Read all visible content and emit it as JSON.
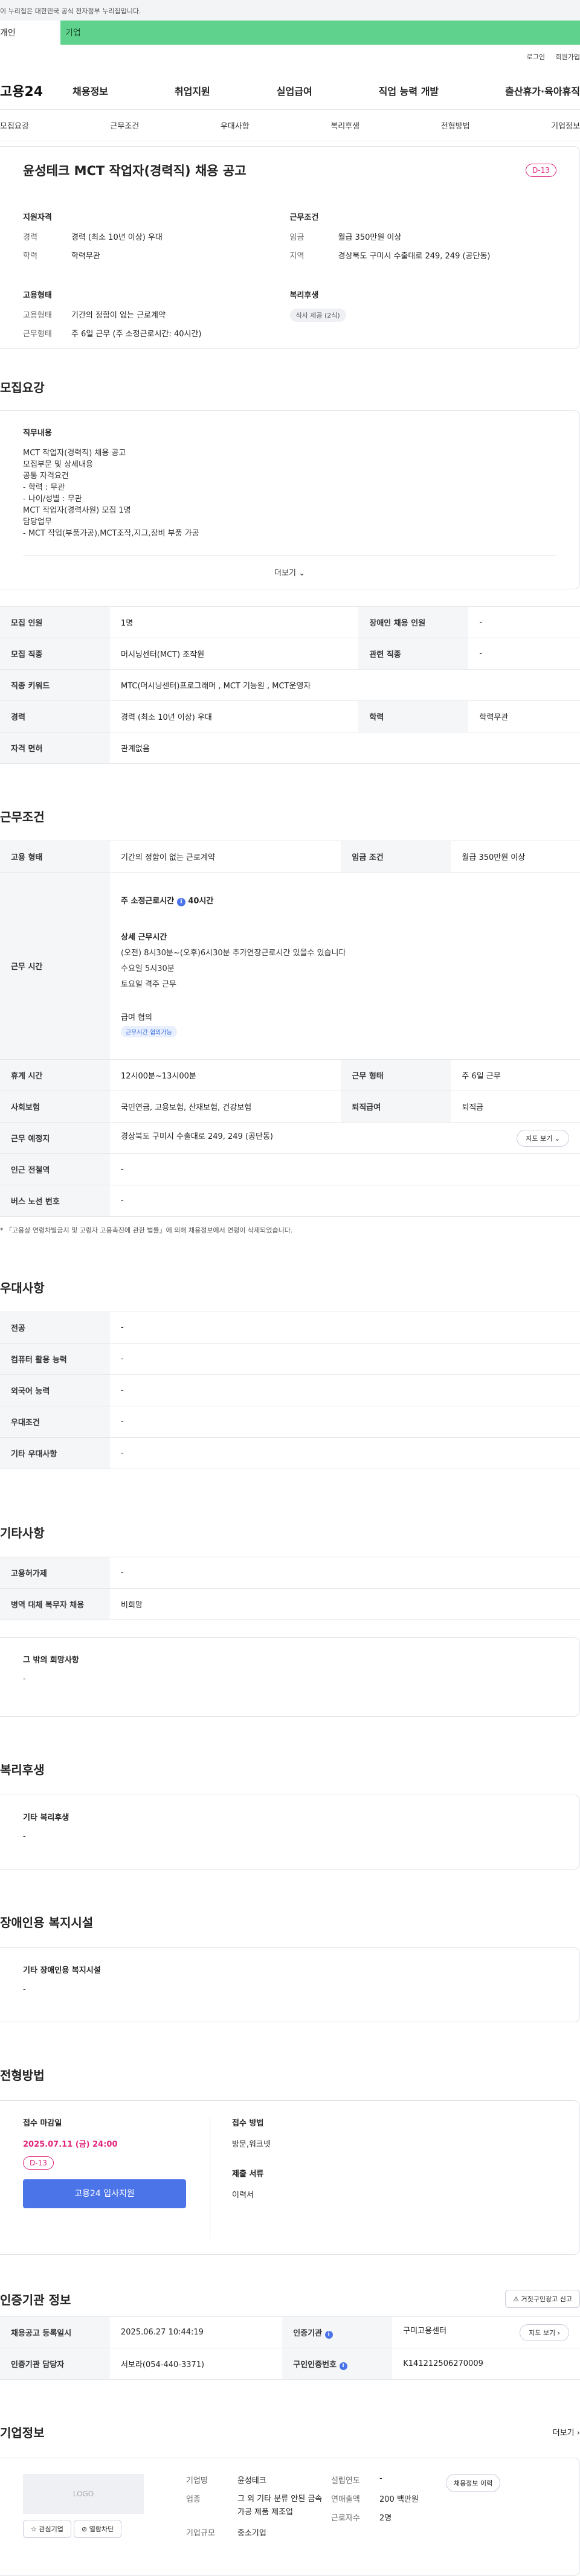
{
  "gov_notice": "이 누리집은 대한민국 공식 전자정부 누리집입니다.",
  "segment": {
    "left": "개인",
    "right": "기업"
  },
  "util": {
    "login": "로그인",
    "join": "회원가입"
  },
  "site": {
    "logo": "고용24"
  },
  "gnb": [
    "채용정보",
    "취업지원",
    "실업급여",
    "직업 능력 개발",
    "출산휴가·육아휴직"
  ],
  "tabs": [
    "모집요강",
    "근무조건",
    "우대사항",
    "복리후생",
    "전형방법",
    "기업정보"
  ],
  "summary": {
    "title": "윤성테크 MCT 작업자(경력직) 채용 공고",
    "dday": "D-13",
    "qual_h": "지원자격",
    "qual": [
      {
        "k": "경력",
        "v": "경력 (최소 10년 이상) 우대"
      },
      {
        "k": "학력",
        "v": "학력무관"
      }
    ],
    "cond_h": "근무조건",
    "cond": [
      {
        "k": "임금",
        "v": "월급 350만원 이상"
      },
      {
        "k": "지역",
        "v": "경상북도 구미시 수출대로 249, 249 (공단동)"
      }
    ],
    "emp_h": "고용형태",
    "emp": [
      {
        "k": "고용형태",
        "v": "기간의 정함이 없는 근로계약"
      },
      {
        "k": "근무형태",
        "v": "주 6일 근무 (주 소정근로시간: 40시간)"
      }
    ],
    "welfare_h": "복리후생",
    "welfare_chip": "식사 제공 (2식)"
  },
  "recruit": {
    "title": "모집요강",
    "detail_h": "직무내용",
    "detail": "MCT 작업자(경력직) 채용 공고\n모집부문 및 상세내용\n공통 자격요건\n- 학력 : 무관\n- 나이/성별 : 무관\nMCT 작업자(경력사원) 모집 1명\n담당업무\n- MCT 작업(부품가공),MCT조작,지그,장비 부품 가공",
    "more": "더보기",
    "rows": [
      {
        "k1": "모집 인원",
        "v1": "1명",
        "k2": "장애인 채용 인원",
        "v2": "-"
      },
      {
        "k1": "모집 직종",
        "v1": "머시닝센터(MCT) 조작원",
        "k2": "관련 직종",
        "v2": "-"
      },
      {
        "k1": "직종 키워드",
        "v1": "MTC(머시닝센터)프로그래머 , MCT 기능원 , MCT운영자"
      },
      {
        "k1": "경력",
        "v1": "경력 (최소 10년 이상) 우대",
        "k2": "학력",
        "v2": "학력무관"
      },
      {
        "k1": "자격 면허",
        "v1": "관계없음"
      }
    ]
  },
  "cond": {
    "title": "근무조건",
    "emp_type_k": "고용 형태",
    "emp_type_v": "기간의 정함이 없는 근로계약",
    "wage_k": "임금 조건",
    "wage_v": "월급 350만원 이상",
    "hours_k": "근무 시간",
    "hours_label": "주 소정근로시간",
    "hours_value": "40시간",
    "hours_detail_h": "상세 근무시간",
    "hours_detail": "(오전) 8시30분~(오후)6시30분   추가연장근로시간 있을수 있습니다\n수요일 5시30분\n토요일 격주 근무",
    "wage_consult": "급여 협의",
    "wage_chip": "근무시간 협의가능",
    "rest_k": "휴게 시간",
    "rest_v": "12시00분~13시00분",
    "shift_k": "근무 형태",
    "shift_v": "주 6일 근무",
    "ins_k": "사회보험",
    "ins_v": "국민연금, 고용보험, 산재보험, 건강보험",
    "sev_k": "퇴직급여",
    "sev_v": "퇴직금",
    "place_k": "근무 예정지",
    "place_v": "경상북도 구미시 수출대로 249, 249 (공단동)",
    "map_btn": "지도 보기",
    "subway_k": "인근 전철역",
    "subway_v": "-",
    "bus_k": "버스 노선 번호",
    "bus_v": "-",
    "note": "* 「고용상 연령차별금지 및 고령자 고용촉진에 관한 법률」에 의해 채용정보에서 연령이 삭제되었습니다."
  },
  "pref": {
    "title": "우대사항",
    "rows": [
      {
        "k": "전공",
        "v": "-"
      },
      {
        "k": "컴퓨터 활용 능력",
        "v": "-"
      },
      {
        "k": "외국어 능력",
        "v": "-"
      },
      {
        "k": "우대조건",
        "v": "-"
      },
      {
        "k": "기타 우대사항",
        "v": "-"
      }
    ]
  },
  "etc": {
    "title": "기타사항",
    "rows": [
      {
        "k": "고용허가제",
        "v": "-"
      },
      {
        "k": "병역 대체 복무자 채용",
        "v": "비희망"
      }
    ],
    "box_h": "그 밖의 희망사항",
    "box_v": "-"
  },
  "welfare": {
    "title": "복리후생",
    "h": "기타 복리후생",
    "v": "-"
  },
  "disab": {
    "title": "장애인용 복지시설",
    "h": "기타 장애인용 복지시설",
    "v": "-"
  },
  "process": {
    "title": "전형방법",
    "deadline_h": "접수 마감일",
    "deadline": "2025.07.11 (금) 24:00",
    "dday": "D-13",
    "apply_btn": "고용24 입사지원",
    "method_h": "접수 방법",
    "method": "방문,워크넷",
    "docs_h": "제출 서류",
    "docs": "이력서"
  },
  "agency": {
    "title": "인증기관 정보",
    "report_btn": "거짓구인광고 신고",
    "reg_k": "채용공고 등록일시",
    "reg_v": "2025.06.27 10:44:19",
    "org_k": "인증기관",
    "org_v": "구미고용센터",
    "map_btn": "지도 보기",
    "mgr_k": "인증기관 담당자",
    "mgr_v": "서보라(054-440-3371)",
    "no_k": "구인인증번호",
    "no_v": "K141212506270009"
  },
  "company": {
    "title": "기업정보",
    "more": "더보기",
    "logo": "LOGO",
    "fav_btn": "관심기업",
    "block_btn": "열람차단",
    "name_k": "기업명",
    "name_v": "윤성테크",
    "ind_k": "업종",
    "ind_v": "그 외 기타 분류 안된 금속 가공 제품 제조업",
    "scale_k": "기업규모",
    "scale_v": "중소기업",
    "est_k": "설립연도",
    "est_v": "-",
    "sales_k": "연매출액",
    "sales_v": "200 백만원",
    "emp_k": "근로자수",
    "emp_v": "2명",
    "jobs_btn": "채용정보 이력"
  }
}
